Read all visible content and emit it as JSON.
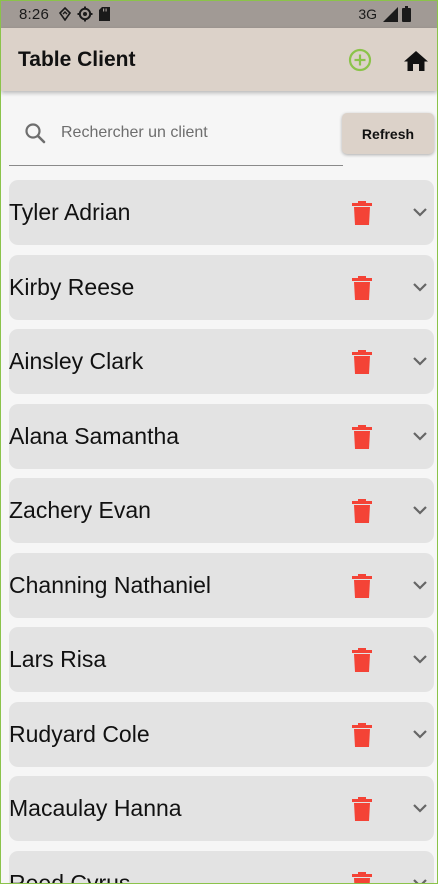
{
  "status_bar": {
    "time": "8:26",
    "network": "3G",
    "icons": [
      "location-icon",
      "settings-gear-icon",
      "sd-card-icon",
      "signal-icon",
      "battery-icon"
    ]
  },
  "app_bar": {
    "title": "Table Client",
    "add_icon": "add-circle-icon",
    "home_icon": "home-icon"
  },
  "search": {
    "placeholder": "Rechercher un client",
    "value": "",
    "refresh_label": "Refresh"
  },
  "clients": [
    {
      "name": "Tyler Adrian"
    },
    {
      "name": "Kirby Reese"
    },
    {
      "name": "Ainsley Clark"
    },
    {
      "name": "Alana Samantha"
    },
    {
      "name": "Zachery Evan"
    },
    {
      "name": "Channing Nathaniel"
    },
    {
      "name": "Lars Risa"
    },
    {
      "name": "Rudyard Cole"
    },
    {
      "name": "Macaulay Hanna"
    },
    {
      "name": "Reed Cyrus"
    }
  ],
  "colors": {
    "app_bar": "#dcd2c9",
    "status_bar": "#a19a95",
    "add_icon": "#8bc34a",
    "delete_icon": "#f44336",
    "card": "#e3e3e3"
  }
}
